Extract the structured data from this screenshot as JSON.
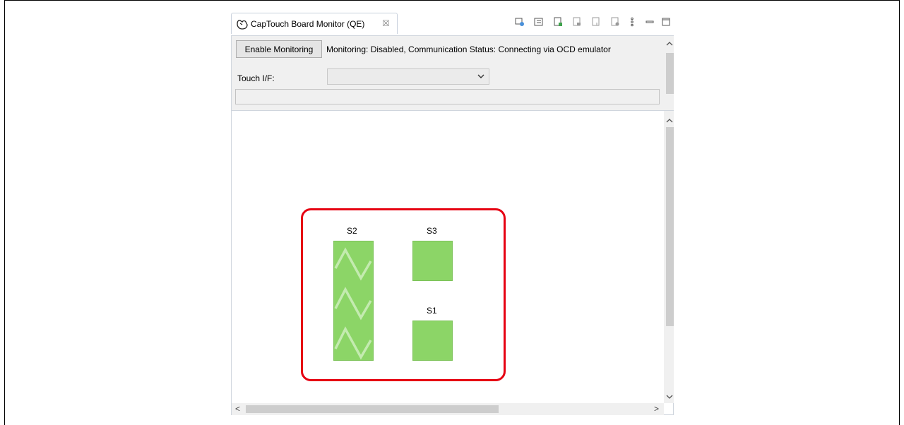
{
  "view": {
    "tab_title": "CapTouch Board Monitor (QE)",
    "tab_close": "☒",
    "tab_icon": "hand-touch-icon",
    "toolbar_icons": [
      "refresh-board-icon",
      "board-layout-icon",
      "export-board-icon",
      "board-icon-2",
      "board-icon-3",
      "board-add-icon",
      "view-menu-icon",
      "minimize-icon",
      "maximize-icon"
    ]
  },
  "monitor": {
    "enable_button": "Enable Monitoring",
    "status_text": "Monitoring: Disabled, Communication Status: Connecting via OCD emulator",
    "touch_if_label": "Touch I/F:",
    "touch_if_value": ""
  },
  "board": {
    "slider_label": "S2",
    "button_top_label": "S3",
    "button_bottom_label": "S1",
    "key_color": "#8cd567",
    "highlight_color": "#e60012"
  },
  "scroll": {
    "left_arrow": "<",
    "right_arrow": ">"
  }
}
